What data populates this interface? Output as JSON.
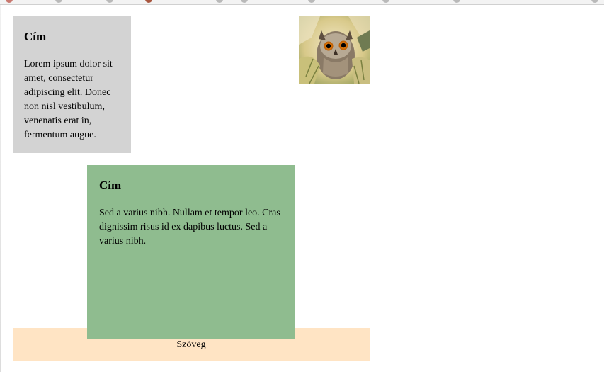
{
  "cards": [
    {
      "title": "Cím",
      "text": "Lorem ipsum dolor sit amet, consectetur adipiscing elit. Donec non nisl vestibulum, venenatis erat in, fermentum augue."
    },
    {
      "title": "Cím",
      "text": "Sed a varius nibh. Nullam et tempor leo. Cras dignissim risus id ex dapibus luctus. Sed a varius nibh."
    }
  ],
  "footer": {
    "text": "Szöveg"
  },
  "colors": {
    "card_grey": "#d3d3d3",
    "card_green": "#8fbc8f",
    "footer_bg": "#ffe4c4"
  }
}
